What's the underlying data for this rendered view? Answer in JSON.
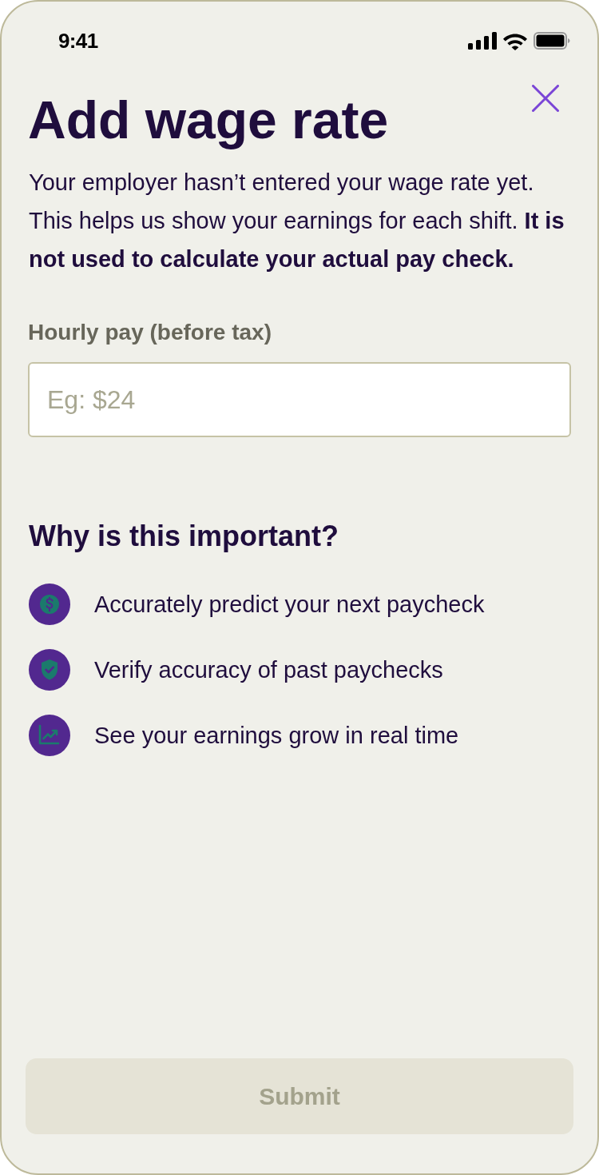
{
  "status_bar": {
    "time": "9:41"
  },
  "header": {
    "title": "Add wage rate"
  },
  "intro": {
    "text": "Your employer hasn’t entered your wage rate yet. This helps us show your earnings for each shift. **It is not used to calculate your actual pay check.**"
  },
  "field": {
    "label": "Hourly pay (before tax)",
    "placeholder": "Eg: $24"
  },
  "benefits": {
    "heading": "Why is this important?",
    "items": [
      {
        "kind": "dollar",
        "text": "Accurately predict your next paycheck"
      },
      {
        "kind": "shield",
        "text": "Verify accuracy of past paychecks"
      },
      {
        "kind": "chart",
        "text": "See your earnings grow in real time"
      }
    ]
  },
  "submit": {
    "label": "Submit",
    "disabled": true
  }
}
